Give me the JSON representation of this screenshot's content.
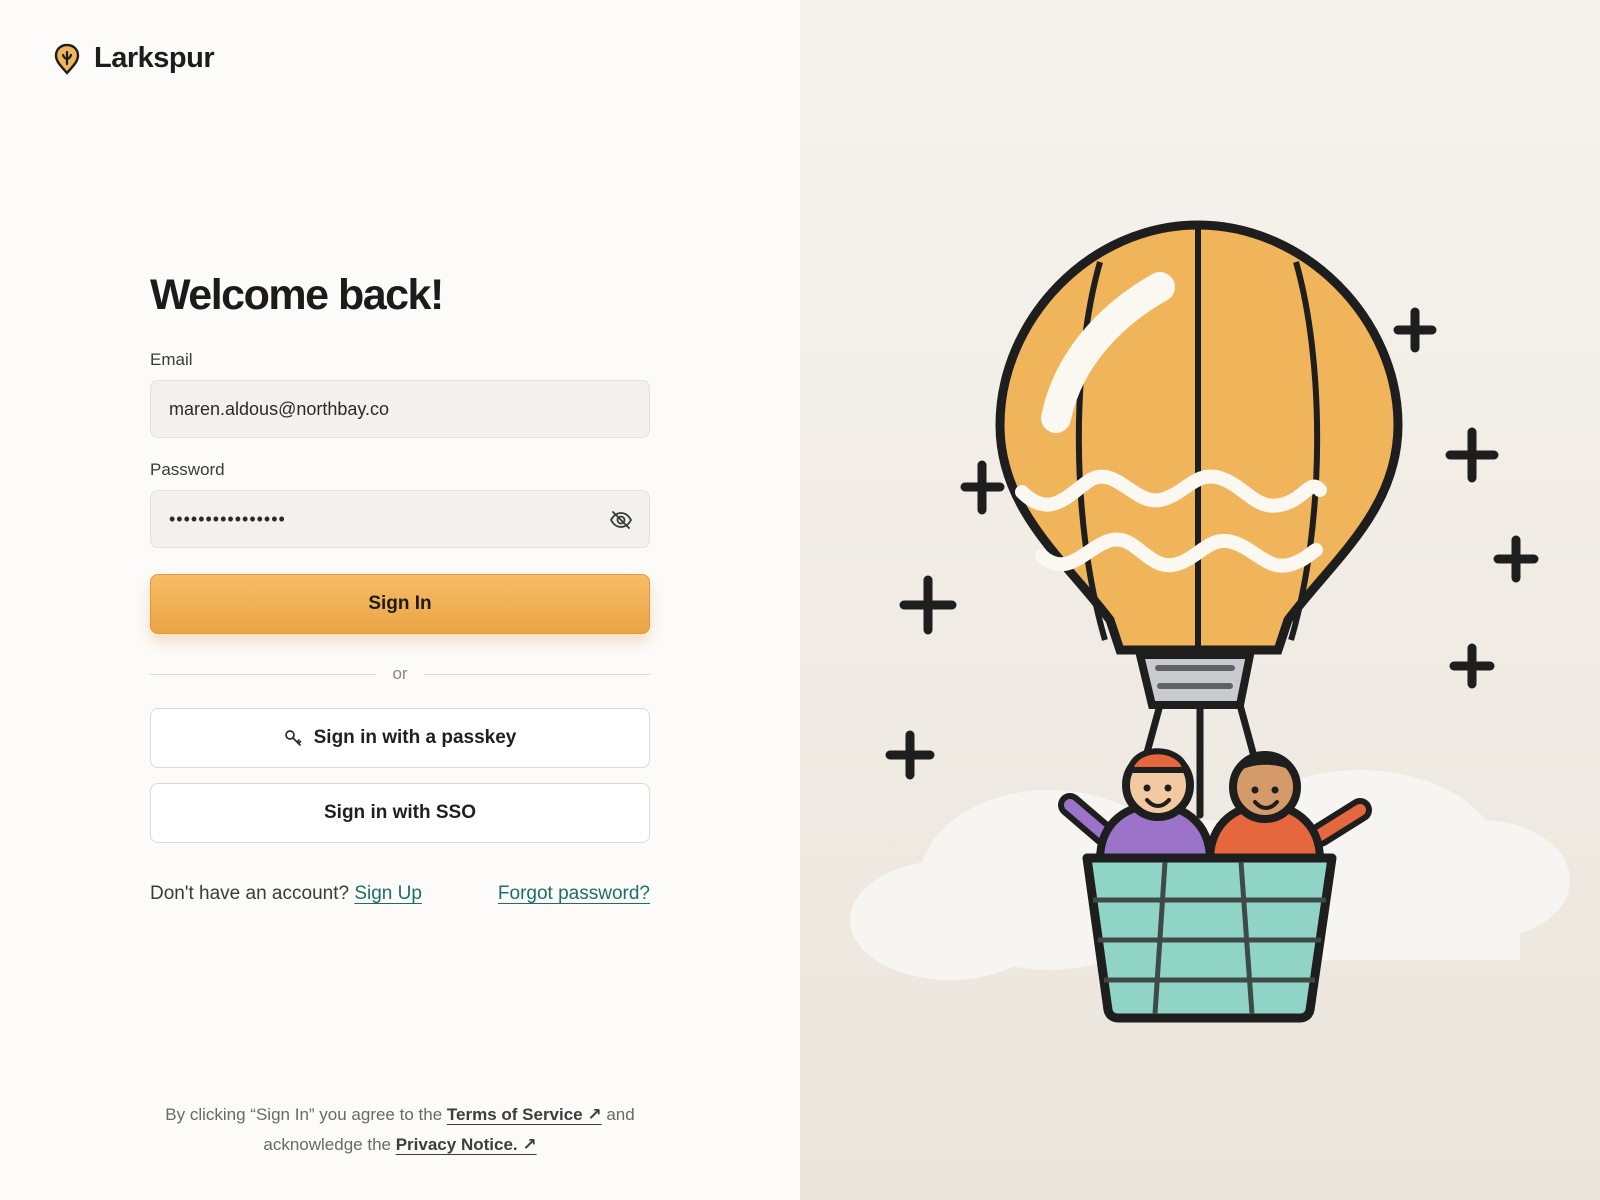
{
  "brand": {
    "name": "Larkspur",
    "logo": "balloon-pin-icon",
    "accent": "#eaa445"
  },
  "form": {
    "title": "Welcome back!",
    "email_label": "Email",
    "email_value": "maren.aldous@northbay.co",
    "password_label": "Password",
    "password_value": "••••••••••••••••",
    "toggle_visibility_icon": "eye-off-icon",
    "sign_in_label": "Sign In",
    "divider_text": "or",
    "passkey_label": "Sign in with a passkey",
    "passkey_icon": "key-icon",
    "sso_label": "Sign in with SSO"
  },
  "footer_links": {
    "no_account_text": "Don't have an account?",
    "sign_up_label": "Sign Up",
    "forgot_label": "Forgot password?",
    "link_color": "#1d6f66"
  },
  "legal": {
    "prefix": "By clicking “Sign In” you agree to the",
    "terms_label": "Terms of Service ↗",
    "middle": "and",
    "acknowledge": "acknowledge the",
    "privacy_label": "Privacy Notice. ↗"
  },
  "illustration": {
    "name": "hot-air-balloon-illustration",
    "balloon_color": "#f0b45a",
    "basket_color": "#8fd4c4"
  }
}
